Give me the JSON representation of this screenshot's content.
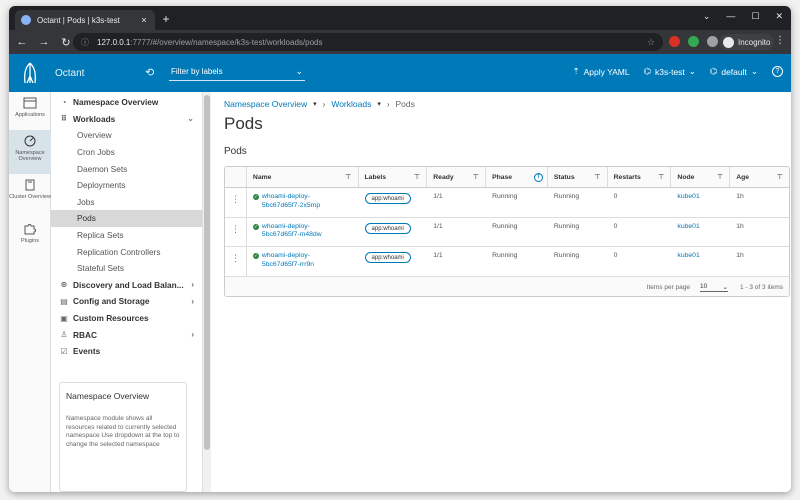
{
  "browser": {
    "tab_title": "Octant | Pods | k3s-test",
    "tab_close": "×",
    "new_tab": "+",
    "url_host": "127.0.0.1",
    "url_rest": ":7777/#/overview/namespace/k3s-test/workloads/pods",
    "incognito_label": "Incognito"
  },
  "header": {
    "brand": "Octant",
    "filter_placeholder": "Filter by labels",
    "apply_yaml": "Apply YAML",
    "context": "k3s-test",
    "namespace": "default",
    "help": "?"
  },
  "rail": [
    {
      "label": "Applications"
    },
    {
      "label": "Namespace Overview"
    },
    {
      "label": "Cluster Overview"
    },
    {
      "label": "Plugins"
    }
  ],
  "sidebar": {
    "namespace_overview": "Namespace Overview",
    "workloads": "Workloads",
    "children": [
      "Overview",
      "Cron Jobs",
      "Daemon Sets",
      "Deployments",
      "Jobs",
      "Pods",
      "Replica Sets",
      "Replication Controllers",
      "Stateful Sets"
    ],
    "discovery": "Discovery and Load Balan...",
    "config": "Config and Storage",
    "custom": "Custom Resources",
    "rbac": "RBAC",
    "events": "Events",
    "card_title": "Namespace Overview",
    "card_body": "Namespace module shows all resources related to currently selected namespace Use dropdown at the top to change the selected namespace"
  },
  "breadcrumb": {
    "item1": "Namespace Overview",
    "item2": "Workloads",
    "current": "Pods"
  },
  "page": {
    "title": "Pods",
    "section": "Pods"
  },
  "table": {
    "columns": [
      "Name",
      "Labels",
      "Ready",
      "Phase",
      "Status",
      "Restarts",
      "Node",
      "Age"
    ],
    "rows": [
      {
        "name": "whoami-deploy-5bc67d65f7-2x5mp",
        "name_l1": "whoami-deploy-",
        "name_l2": "5bc67d65f7-2x5mp",
        "label": "app:whoami",
        "ready": "1/1",
        "phase": "Running",
        "status": "Running",
        "restarts": "0",
        "node": "kube01",
        "age": "1h"
      },
      {
        "name": "whoami-deploy-5bc67d65f7-m48dw",
        "name_l1": "whoami-deploy-",
        "name_l2": "5bc67d65f7-m48dw",
        "label": "app:whoami",
        "ready": "1/1",
        "phase": "Running",
        "status": "Running",
        "restarts": "0",
        "node": "kube01",
        "age": "1h"
      },
      {
        "name": "whoami-deploy-5bc67d65f7-rrr9n",
        "name_l1": "whoami-deploy-",
        "name_l2": "5bc67d65f7-rrr9n",
        "label": "app:whoami",
        "ready": "1/1",
        "phase": "Running",
        "status": "Running",
        "restarts": "0",
        "node": "kube01",
        "age": "1h"
      }
    ],
    "items_per_page_label": "Items per page",
    "items_per_page": "10",
    "range": "1 - 3 of 3 items"
  },
  "colors": {
    "header_bg": "#0079b8",
    "link": "#0079b8",
    "ok": "#2e8540"
  }
}
